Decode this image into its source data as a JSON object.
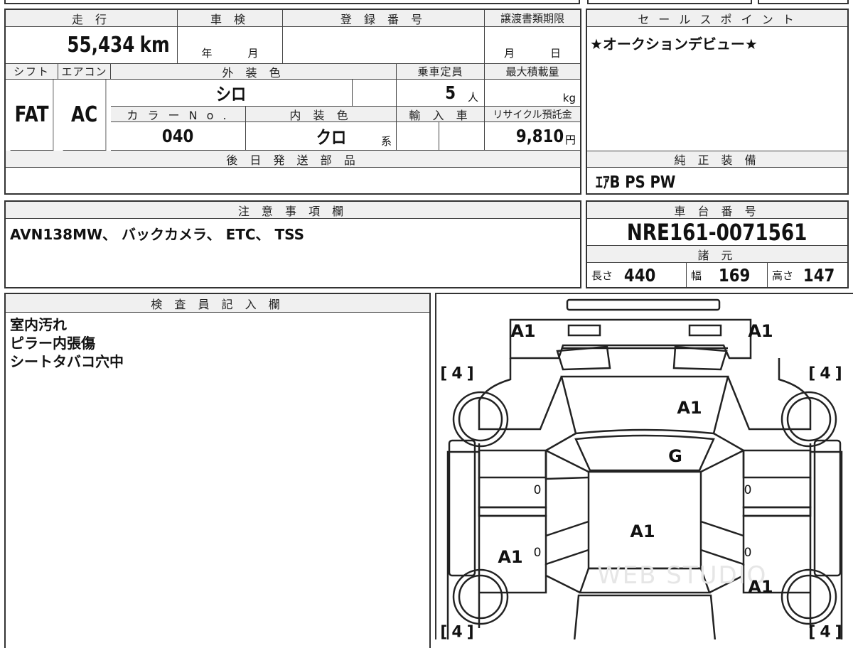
{
  "header": {
    "mileage_label": "走 行",
    "shaken_label": "車 検",
    "registration_label": "登 録 番 号",
    "transfer_deadline_label": "譲渡書類期限",
    "sales_point_label": "セ ー ル ス ポ イ ン ト"
  },
  "mileage": {
    "value": "55,434",
    "unit": "km"
  },
  "shaken": {
    "year": "年",
    "month": "月"
  },
  "transfer_deadline": {
    "month": "月",
    "day": "日"
  },
  "sales_point": {
    "text": "★オークションデビュー★"
  },
  "row2": {
    "shift_label": "シフト",
    "aircon_label": "エアコン",
    "exterior_label": "外 装 色",
    "capacity_label": "乗車定員",
    "max_load_label": "最大積載量",
    "shift": "FAT",
    "aircon": "AC",
    "exterior_color": "シロ",
    "capacity": "5",
    "capacity_unit": "人",
    "max_load_unit": "kg"
  },
  "row3": {
    "color_no_label": "カ ラ ー N o .",
    "interior_label": "内 装 色",
    "import_label": "輸 入 車",
    "recycle_label": "リサイクル預託金",
    "color_no": "040",
    "interior_color": "クロ",
    "interior_suffix": "系",
    "recycle_fee": "9,810",
    "recycle_unit": "円"
  },
  "later_parts": {
    "label": "後 日 発 送 部 品",
    "value": ""
  },
  "genuine_equipment": {
    "label": "純 正 装 備",
    "value": "ｴｱB  PS  PW"
  },
  "notes": {
    "label": "注 意 事 項 欄",
    "value": "AVN138MW、 バックカメラ、 ETC、  TSS"
  },
  "chassis": {
    "label": "車 台 番 号",
    "value": "NRE161-0071561"
  },
  "specs": {
    "label": "諸 元",
    "length_label": "長さ",
    "length": "440",
    "width_label": "幅",
    "width": "169",
    "height_label": "高さ",
    "height": "147"
  },
  "inspector": {
    "label": "検 査 員 記 入 欄",
    "lines": [
      "室内汚れ",
      "ピラー内張傷",
      "シートタバコ穴中"
    ]
  },
  "diagram": {
    "marks": [
      "A1",
      "A1",
      "A1",
      "G",
      "A1",
      "A1",
      "A1"
    ],
    "tires": [
      "4",
      "4",
      "4",
      "4"
    ],
    "doors": [
      "0",
      "0",
      "0",
      "0"
    ],
    "watermark": "WEB STUDIO"
  }
}
